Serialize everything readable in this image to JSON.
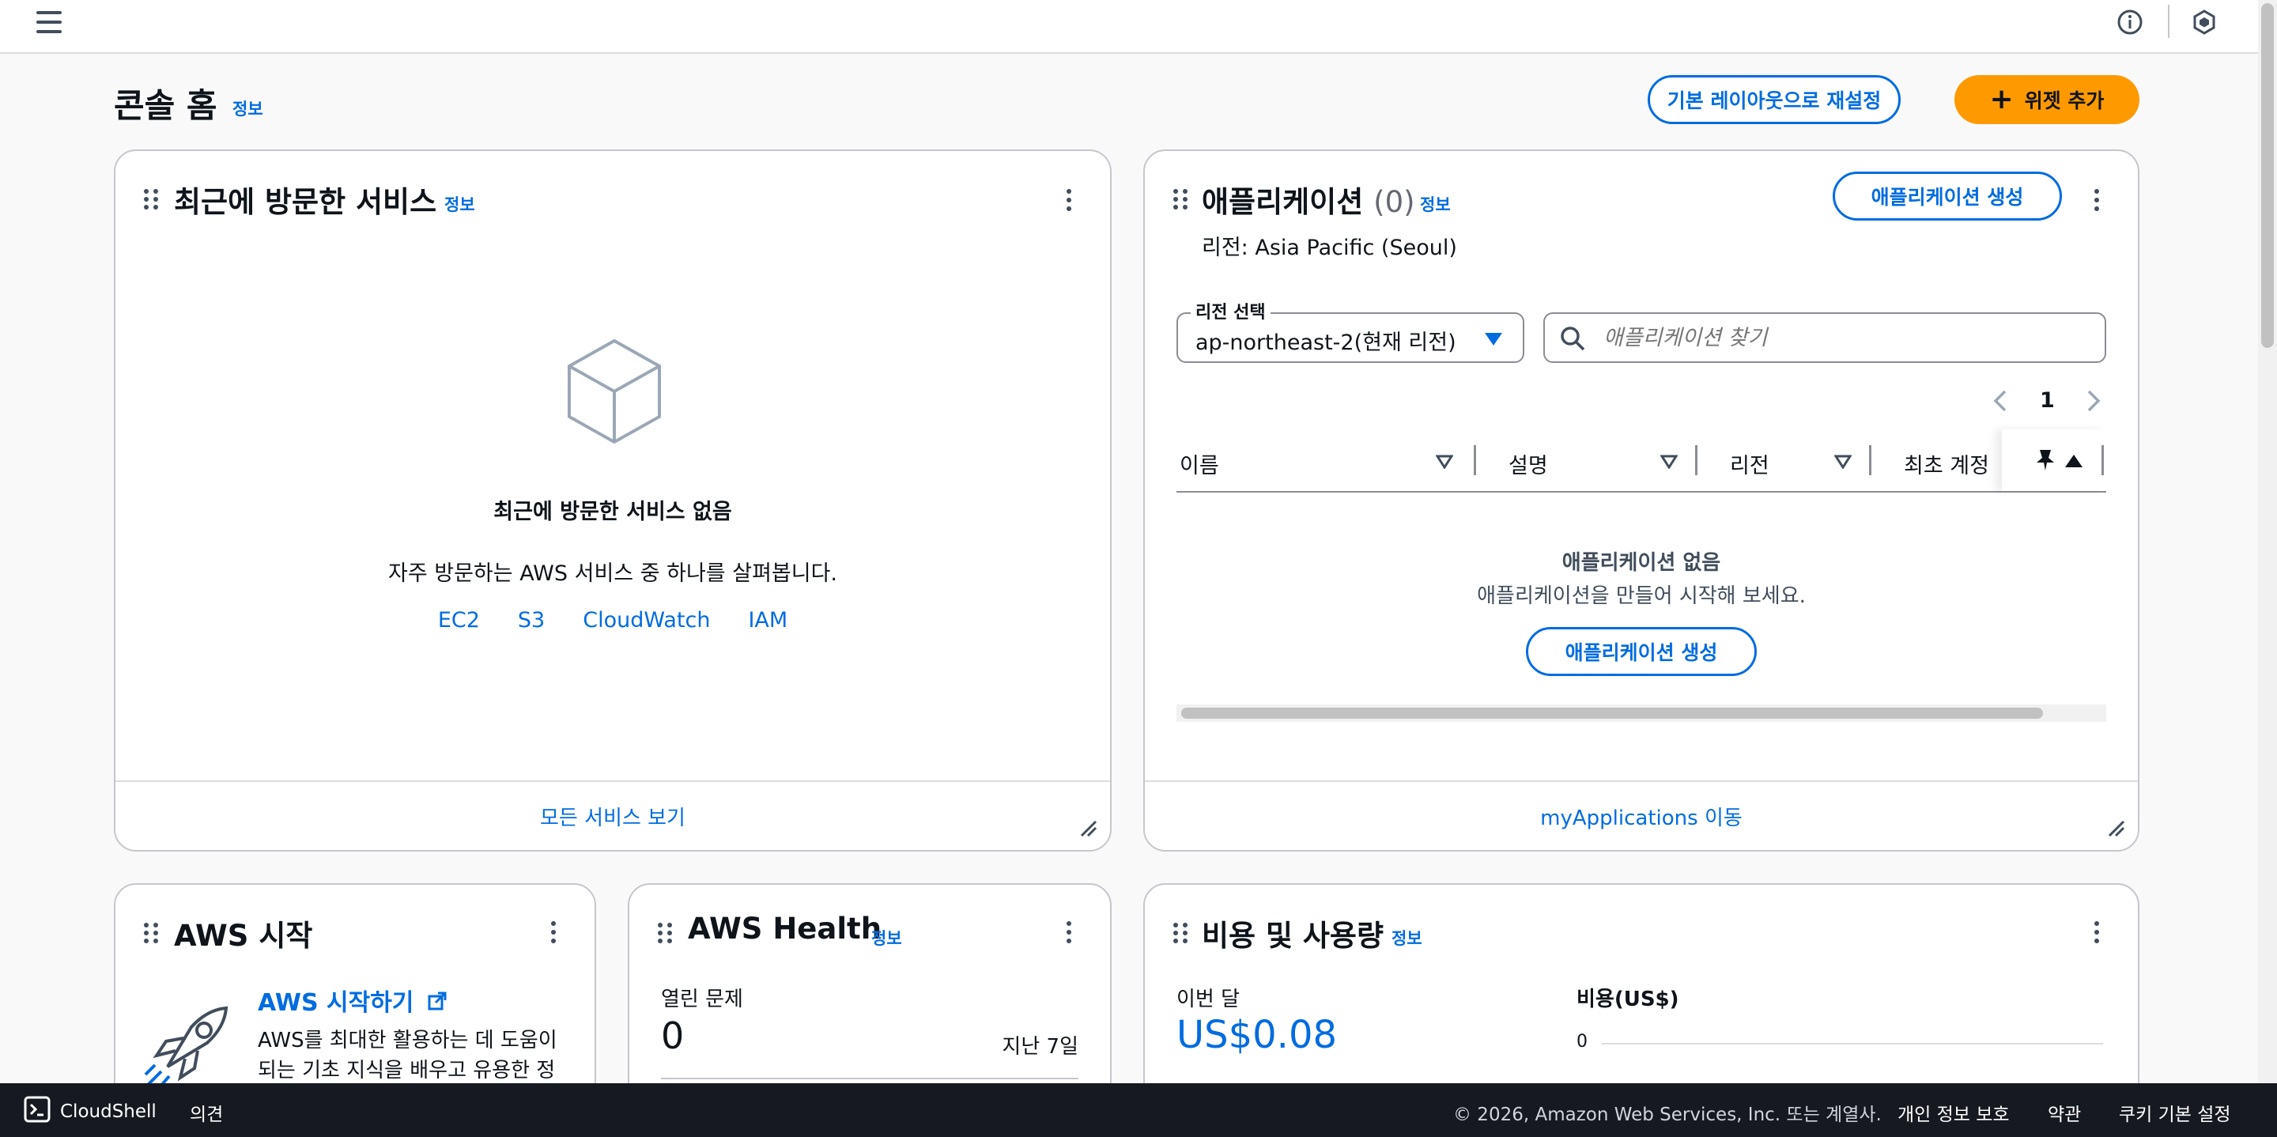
{
  "topbar": {
    "menu_icon": "hamburger-icon",
    "info_icon": "info-circle-icon",
    "settings_icon": "hexagon-shield-icon"
  },
  "page": {
    "title": "콘솔 홈",
    "info": "정보",
    "reset_button": "기본 레이아웃으로 재설정",
    "add_widget_button": "위젯 추가"
  },
  "recent_services": {
    "title": "최근에 방문한 서비스",
    "info": "정보",
    "empty_title": "최근에 방문한 서비스 없음",
    "empty_desc": "자주 방문하는 AWS 서비스 중 하나를 살펴봅니다.",
    "links": [
      "EC2",
      "S3",
      "CloudWatch",
      "IAM"
    ],
    "footer_link": "모든 서비스 보기"
  },
  "applications": {
    "title": "애플리케이션",
    "count": "(0)",
    "info": "정보",
    "create_button": "애플리케이션 생성",
    "region_text": "리전: Asia Pacific (Seoul)",
    "region_select_label": "리전 선택",
    "region_select_value": "ap-northeast-2(현재 리전)",
    "search_placeholder": "애플리케이션 찾기",
    "page_number": "1",
    "columns": [
      "이름",
      "설명",
      "리전",
      "최초 계정"
    ],
    "empty_title": "애플리케이션 없음",
    "empty_desc": "애플리케이션을 만들어 시작해 보세요.",
    "empty_create_button": "애플리케이션 생성",
    "footer_link": "myApplications 이동"
  },
  "aws_start": {
    "title": "AWS 시작",
    "link": "AWS 시작하기",
    "desc_line1": "AWS를 최대한 활용하는 데 도움이",
    "desc_line2": "되는 기초 지식을 배우고 유용한 정"
  },
  "aws_health": {
    "title": "AWS Health",
    "info": "정보",
    "open_issues_label": "열린 문제",
    "open_issues_value": "0",
    "period": "지난 7일"
  },
  "cost": {
    "title": "비용 및 사용량",
    "info": "정보",
    "this_month_label": "이번 달",
    "this_month_value": "US$0.08",
    "chart_label": "비용(US$)",
    "chart_axis_zero": "0"
  },
  "bottombar": {
    "cloudshell": "CloudShell",
    "feedback": "의견",
    "copyright": "© 2026, Amazon Web Services, Inc. 또는 계열사.",
    "privacy": "개인 정보 보호",
    "terms": "약관",
    "cookies": "쿠키 기본 설정"
  },
  "colors": {
    "link": "#006ce0",
    "primary_button": "#ff9900",
    "footer_bg": "#16191f"
  }
}
